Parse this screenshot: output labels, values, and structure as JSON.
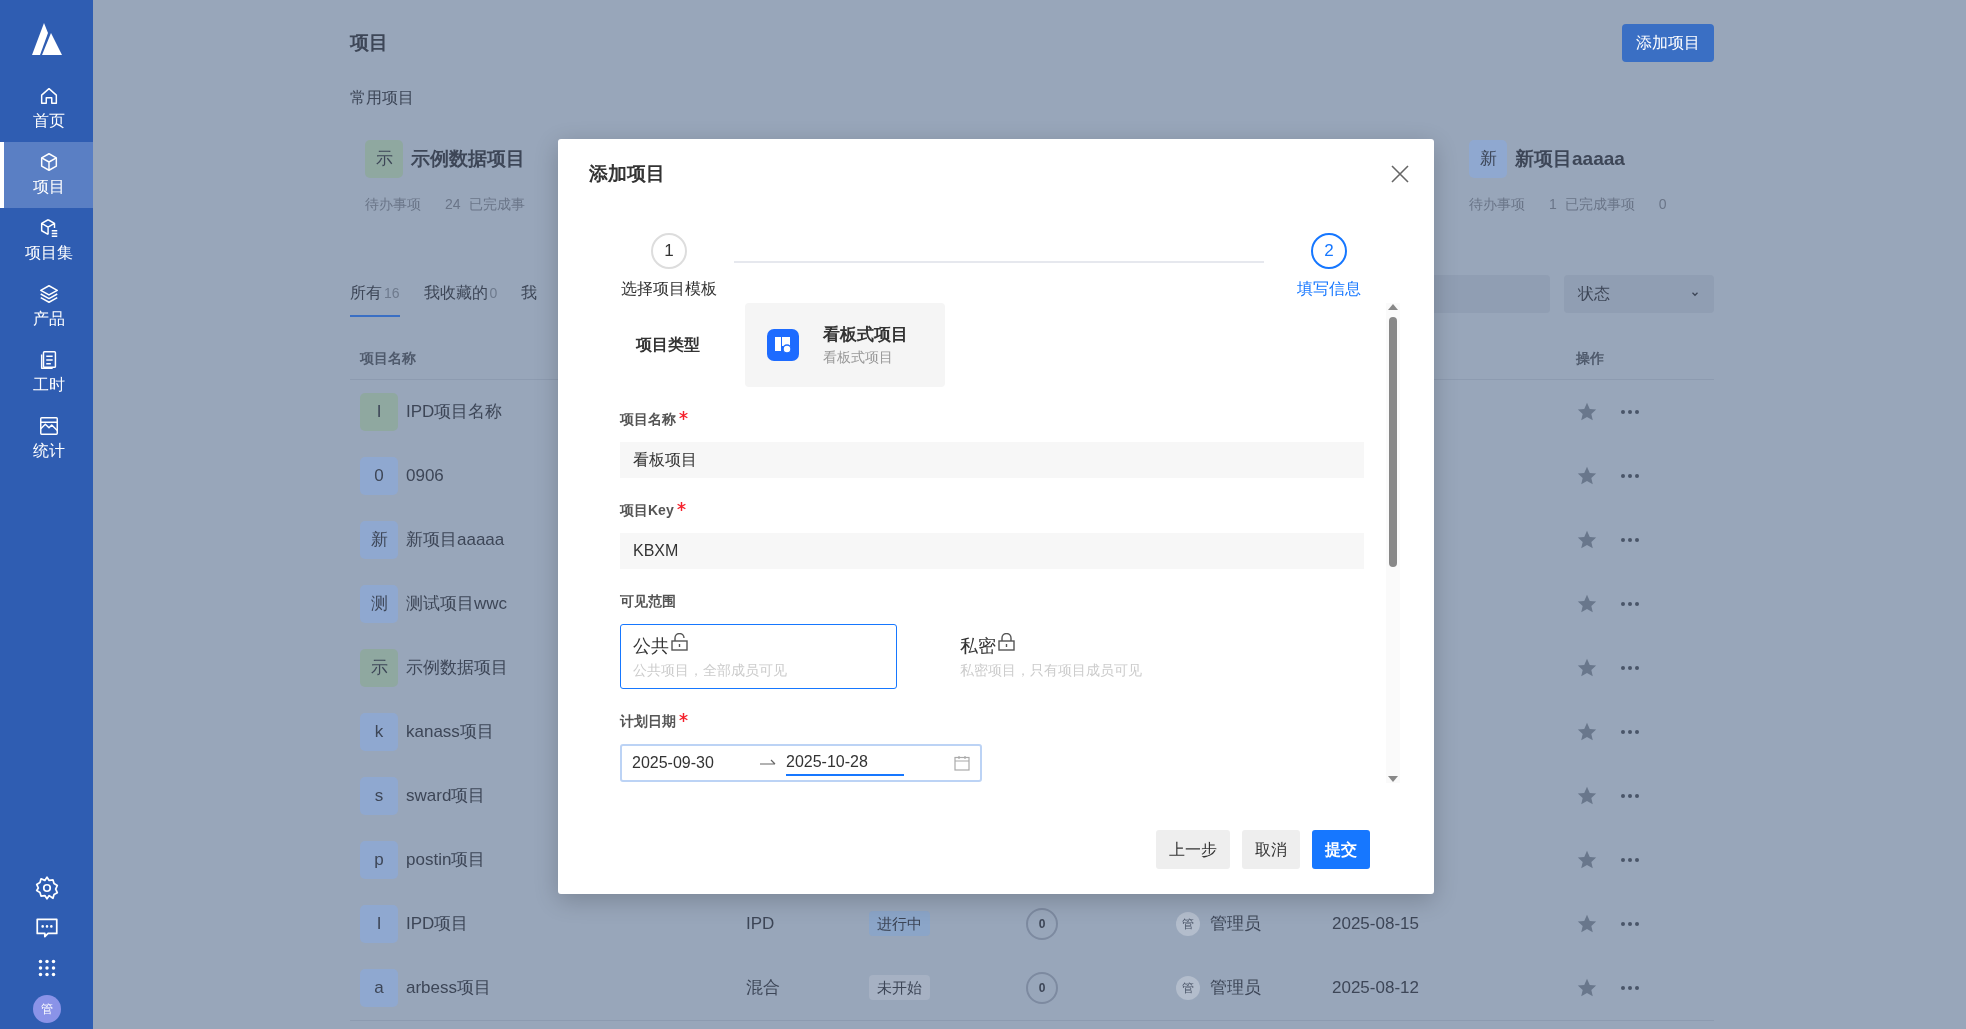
{
  "sidebar": {
    "items": [
      {
        "label": "首页",
        "selected": false
      },
      {
        "label": "项目",
        "selected": true
      },
      {
        "label": "项目集",
        "selected": false
      },
      {
        "label": "产品",
        "selected": false
      },
      {
        "label": "工时",
        "selected": false
      },
      {
        "label": "统计",
        "selected": false
      }
    ],
    "user_avatar": "管"
  },
  "page": {
    "title": "项目",
    "add_button": "添加项目",
    "favorites_title": "常用项目",
    "favorites": [
      {
        "avatar": "示",
        "color": "#8fa8a0",
        "name": "示例数据项目",
        "todo_label": "待办事项",
        "todo_count": "24",
        "done_label": "已完成事"
      },
      {
        "avatar": "新",
        "color": "#8fa8d0",
        "name": "新项目aaaaa",
        "todo_label": "待办事项",
        "todo_count": "1",
        "done_label": "已完成事项",
        "done_count": "0"
      }
    ],
    "tabs": [
      {
        "label": "所有",
        "count": "16",
        "selected": true
      },
      {
        "label": "我收藏的",
        "count": "0",
        "selected": false
      },
      {
        "label": "我",
        "selected": false
      }
    ],
    "status_filter": {
      "placeholder": "状态"
    }
  },
  "table": {
    "columns": [
      "项目名称",
      "操作"
    ],
    "rows": [
      {
        "avatar": "I",
        "color": "#8fa8a0",
        "name": "IPD项目名称"
      },
      {
        "avatar": "0",
        "color": "#8fa8d0",
        "name": "0906"
      },
      {
        "avatar": "新",
        "color": "#8fa8d0",
        "name": "新项目aaaaa"
      },
      {
        "avatar": "测",
        "color": "#8fa8d0",
        "name": "测试项目wwc"
      },
      {
        "avatar": "示",
        "color": "#8fa8a0",
        "name": "示例数据项目"
      },
      {
        "avatar": "k",
        "color": "#8fa8d0",
        "name": "kanass项目"
      },
      {
        "avatar": "s",
        "color": "#8fa8d0",
        "name": "sward项目"
      },
      {
        "avatar": "p",
        "color": "#8fa8d0",
        "name": "postin项目"
      },
      {
        "avatar": "I",
        "color": "#8fa8d0",
        "name": "IPD项目",
        "type": "IPD",
        "status": {
          "label": "进行中",
          "color": "#8ba5c8"
        },
        "count": "0",
        "owner_avatar": "管",
        "owner": "管理员",
        "date": "2025-08-15"
      },
      {
        "avatar": "a",
        "color": "#8fa8d0",
        "name": "arbess项目",
        "type": "混合",
        "status": {
          "label": "未开始",
          "color": "#a6b1c3"
        },
        "count": "0",
        "owner_avatar": "管",
        "owner": "管理员",
        "date": "2025-08-12"
      }
    ]
  },
  "dialog": {
    "title": "添加项目",
    "steps": [
      {
        "number": "1",
        "label": "选择项目模板",
        "selected": false
      },
      {
        "number": "2",
        "label": "填写信息",
        "selected": true
      }
    ],
    "project_type": {
      "label": "项目类型",
      "name": "看板式项目",
      "description": "看板式项目"
    },
    "fields": [
      {
        "label": "项目名称",
        "required": true,
        "value": "看板项目"
      },
      {
        "label": "项目Key",
        "required": true,
        "value": "KBXM"
      }
    ],
    "visibility": {
      "label": "可见范围",
      "options": [
        {
          "label": "公共",
          "description": "公共项目，全部成员可见",
          "locked": false,
          "selected": true
        },
        {
          "label": "私密",
          "description": "私密项目，只有项目成员可见",
          "locked": true,
          "selected": false
        }
      ]
    },
    "date_range": {
      "label": "计划日期",
      "required": true,
      "start": "2025-09-30",
      "end": "2025-10-28"
    },
    "buttons": [
      {
        "label": "上一步",
        "primary": false
      },
      {
        "label": "取消",
        "primary": false
      },
      {
        "label": "提交",
        "primary": true
      }
    ]
  }
}
